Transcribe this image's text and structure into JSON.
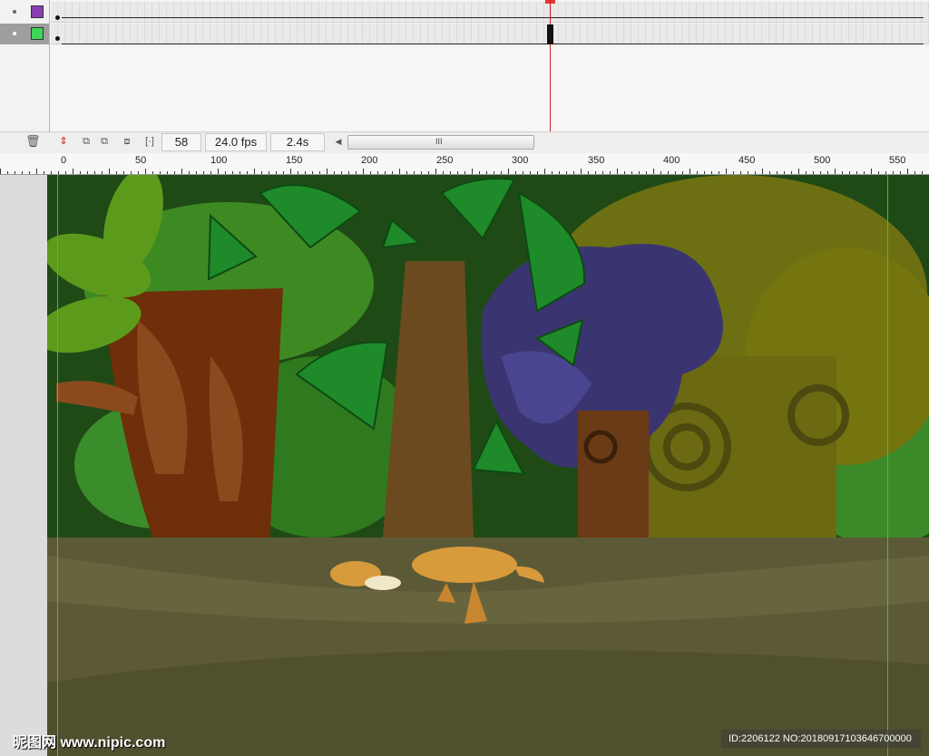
{
  "timeline": {
    "layers": [
      {
        "name": "",
        "color": "#8a3fb0",
        "selected": false
      },
      {
        "name": "",
        "color": "#3fd55a",
        "selected": true
      }
    ],
    "current_frame": "58",
    "frame_rate": "24.0 fps",
    "elapsed_time": "2.4s",
    "scroll_grip": "III"
  },
  "toolbar": {
    "icons": [
      "trash-icon",
      "center-frame-icon",
      "onion-skin-icon",
      "onion-skin-outlines-icon",
      "edit-multiple-frames-icon",
      "modify-onion-markers-icon",
      "scroll-left-icon"
    ]
  },
  "ruler": {
    "labels": [
      "0",
      "50",
      "100",
      "150",
      "200",
      "250",
      "300",
      "350",
      "400",
      "450",
      "500",
      "550"
    ]
  },
  "stage": {
    "background_color": "#1f4a16",
    "ground_color": "#5c5a36"
  },
  "watermark": {
    "left": "昵图网 www.nipic.com",
    "right": "ID:2206122 NO:20180917103646700000"
  }
}
